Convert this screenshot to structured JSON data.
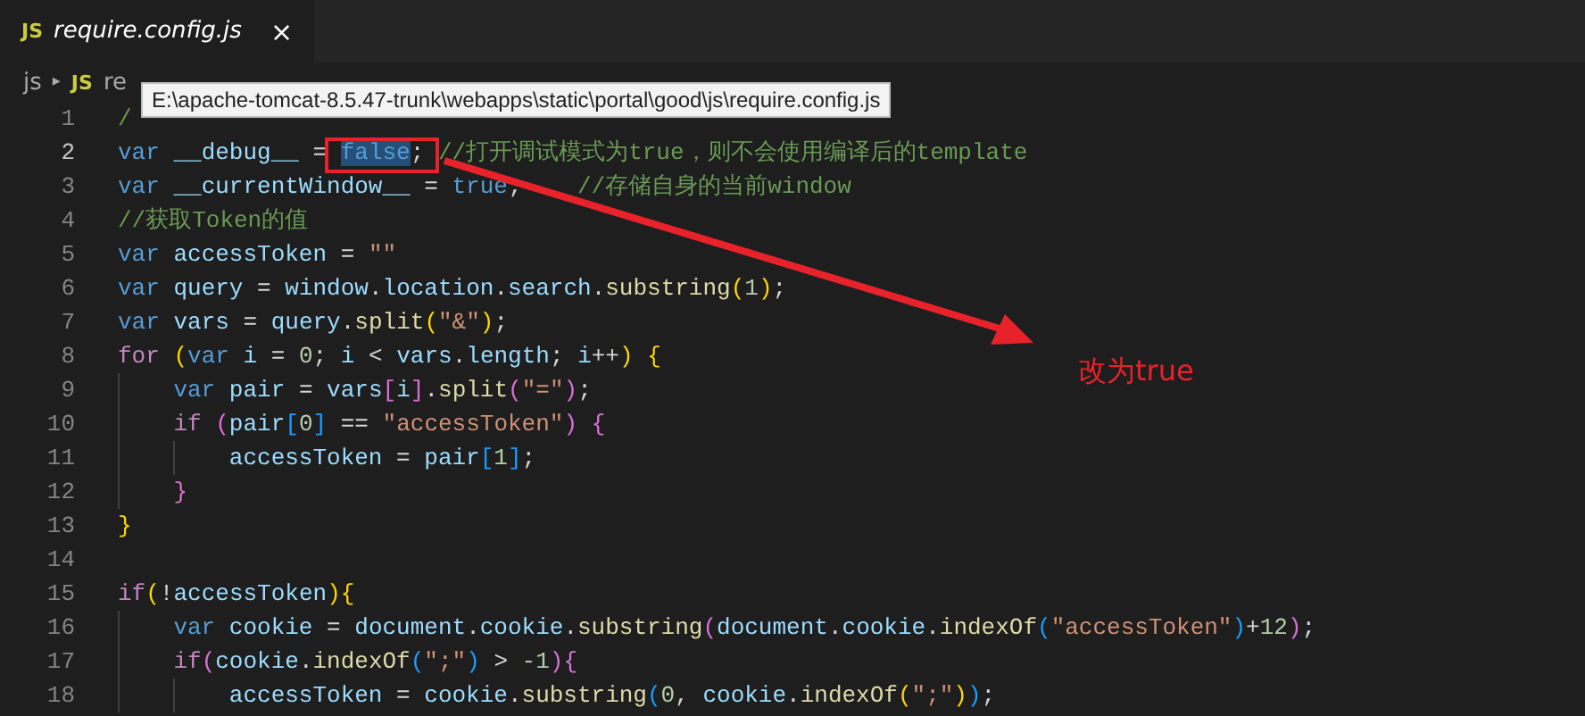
{
  "tabs": [
    {
      "badge": "JS",
      "label": "require.config.js",
      "close": "×",
      "selected": true
    }
  ],
  "breadcrumb": {
    "folder": "js",
    "separator": "▸",
    "badge": "JS",
    "file": "re"
  },
  "tooltip": "E:\\apache-tomcat-8.5.47-trunk\\webapps\\static\\portal\\good\\js\\require.config.js",
  "lines": [
    {
      "number": "1",
      "current": false,
      "tokens": [
        {
          "text": "/",
          "kind": "comment"
        }
      ]
    },
    {
      "number": "2",
      "current": true,
      "tokens": [
        {
          "text": "var ",
          "kind": "keyword"
        },
        {
          "text": "__debug__",
          "kind": "variable"
        },
        {
          "text": " = ",
          "kind": "plain"
        },
        {
          "text": "false",
          "kind": "keyword",
          "selected": true
        },
        {
          "text": "; ",
          "kind": "plain"
        },
        {
          "text": "//打开调试模式为true，则不会使用编译后的template",
          "kind": "comment"
        }
      ]
    },
    {
      "number": "3",
      "current": false,
      "tokens": [
        {
          "text": "var ",
          "kind": "keyword"
        },
        {
          "text": "__currentWindow__",
          "kind": "variable"
        },
        {
          "text": " = ",
          "kind": "plain"
        },
        {
          "text": "true",
          "kind": "keyword"
        },
        {
          "text": ";    ",
          "kind": "plain"
        },
        {
          "text": "//存储自身的当前window",
          "kind": "comment"
        }
      ]
    },
    {
      "number": "4",
      "current": false,
      "tokens": [
        {
          "text": "//获取Token的值",
          "kind": "comment"
        }
      ]
    },
    {
      "number": "5",
      "current": false,
      "tokens": [
        {
          "text": "var ",
          "kind": "keyword"
        },
        {
          "text": "accessToken",
          "kind": "variable"
        },
        {
          "text": " = ",
          "kind": "plain"
        },
        {
          "text": "\"\"",
          "kind": "string"
        }
      ]
    },
    {
      "number": "6",
      "current": false,
      "tokens": [
        {
          "text": "var ",
          "kind": "keyword"
        },
        {
          "text": "query",
          "kind": "variable"
        },
        {
          "text": " = ",
          "kind": "plain"
        },
        {
          "text": "window",
          "kind": "variable"
        },
        {
          "text": ".",
          "kind": "plain"
        },
        {
          "text": "location",
          "kind": "variable"
        },
        {
          "text": ".",
          "kind": "plain"
        },
        {
          "text": "search",
          "kind": "variable"
        },
        {
          "text": ".",
          "kind": "plain"
        },
        {
          "text": "substring",
          "kind": "function"
        },
        {
          "text": "(",
          "kind": "bracket1"
        },
        {
          "text": "1",
          "kind": "number"
        },
        {
          "text": ")",
          "kind": "bracket1"
        },
        {
          "text": ";",
          "kind": "plain"
        }
      ]
    },
    {
      "number": "7",
      "current": false,
      "tokens": [
        {
          "text": "var ",
          "kind": "keyword"
        },
        {
          "text": "vars",
          "kind": "variable"
        },
        {
          "text": " = ",
          "kind": "plain"
        },
        {
          "text": "query",
          "kind": "variable"
        },
        {
          "text": ".",
          "kind": "plain"
        },
        {
          "text": "split",
          "kind": "function"
        },
        {
          "text": "(",
          "kind": "bracket1"
        },
        {
          "text": "\"&\"",
          "kind": "string"
        },
        {
          "text": ")",
          "kind": "bracket1"
        },
        {
          "text": ";",
          "kind": "plain"
        }
      ]
    },
    {
      "number": "8",
      "current": false,
      "tokens": [
        {
          "text": "for ",
          "kind": "control"
        },
        {
          "text": "(",
          "kind": "bracket1"
        },
        {
          "text": "var ",
          "kind": "keyword"
        },
        {
          "text": "i",
          "kind": "variable"
        },
        {
          "text": " = ",
          "kind": "plain"
        },
        {
          "text": "0",
          "kind": "number"
        },
        {
          "text": "; ",
          "kind": "plain"
        },
        {
          "text": "i",
          "kind": "variable"
        },
        {
          "text": " < ",
          "kind": "plain"
        },
        {
          "text": "vars",
          "kind": "variable"
        },
        {
          "text": ".",
          "kind": "plain"
        },
        {
          "text": "length",
          "kind": "variable"
        },
        {
          "text": "; ",
          "kind": "plain"
        },
        {
          "text": "i",
          "kind": "variable"
        },
        {
          "text": "++",
          "kind": "plain"
        },
        {
          "text": ") {",
          "kind": "bracket1"
        }
      ]
    },
    {
      "number": "9",
      "current": false,
      "tokens": [
        {
          "text": "    var ",
          "kind": "keyword"
        },
        {
          "text": "pair",
          "kind": "variable"
        },
        {
          "text": " = ",
          "kind": "plain"
        },
        {
          "text": "vars",
          "kind": "variable"
        },
        {
          "text": "[",
          "kind": "bracket2"
        },
        {
          "text": "i",
          "kind": "variable"
        },
        {
          "text": "]",
          "kind": "bracket2"
        },
        {
          "text": ".",
          "kind": "plain"
        },
        {
          "text": "split",
          "kind": "function"
        },
        {
          "text": "(",
          "kind": "bracket2"
        },
        {
          "text": "\"=\"",
          "kind": "string"
        },
        {
          "text": ")",
          "kind": "bracket2"
        },
        {
          "text": ";",
          "kind": "plain"
        }
      ]
    },
    {
      "number": "10",
      "current": false,
      "tokens": [
        {
          "text": "    if ",
          "kind": "control"
        },
        {
          "text": "(",
          "kind": "bracket2"
        },
        {
          "text": "pair",
          "kind": "variable"
        },
        {
          "text": "[",
          "kind": "bracket3"
        },
        {
          "text": "0",
          "kind": "number"
        },
        {
          "text": "]",
          "kind": "bracket3"
        },
        {
          "text": " == ",
          "kind": "plain"
        },
        {
          "text": "\"accessToken\"",
          "kind": "string"
        },
        {
          "text": ") {",
          "kind": "bracket2"
        }
      ]
    },
    {
      "number": "11",
      "current": false,
      "tokens": [
        {
          "text": "        accessToken",
          "kind": "variable"
        },
        {
          "text": " = ",
          "kind": "plain"
        },
        {
          "text": "pair",
          "kind": "variable"
        },
        {
          "text": "[",
          "kind": "bracket3"
        },
        {
          "text": "1",
          "kind": "number"
        },
        {
          "text": "]",
          "kind": "bracket3"
        },
        {
          "text": ";",
          "kind": "plain"
        }
      ]
    },
    {
      "number": "12",
      "current": false,
      "tokens": [
        {
          "text": "    }",
          "kind": "bracket2"
        }
      ]
    },
    {
      "number": "13",
      "current": false,
      "tokens": [
        {
          "text": "}",
          "kind": "bracket1"
        }
      ]
    },
    {
      "number": "14",
      "current": false
    },
    {
      "number": "15",
      "current": false,
      "tokens": [
        {
          "text": "if",
          "kind": "control"
        },
        {
          "text": "(",
          "kind": "bracket1"
        },
        {
          "text": "!",
          "kind": "plain"
        },
        {
          "text": "accessToken",
          "kind": "variable"
        },
        {
          "text": "){",
          "kind": "bracket1"
        }
      ]
    },
    {
      "number": "16",
      "current": false,
      "tokens": [
        {
          "text": "    var ",
          "kind": "keyword"
        },
        {
          "text": "cookie",
          "kind": "variable"
        },
        {
          "text": " = ",
          "kind": "plain"
        },
        {
          "text": "document",
          "kind": "variable"
        },
        {
          "text": ".",
          "kind": "plain"
        },
        {
          "text": "cookie",
          "kind": "variable"
        },
        {
          "text": ".",
          "kind": "plain"
        },
        {
          "text": "substring",
          "kind": "function"
        },
        {
          "text": "(",
          "kind": "bracket2"
        },
        {
          "text": "document",
          "kind": "variable"
        },
        {
          "text": ".",
          "kind": "plain"
        },
        {
          "text": "cookie",
          "kind": "variable"
        },
        {
          "text": ".",
          "kind": "plain"
        },
        {
          "text": "indexOf",
          "kind": "function"
        },
        {
          "text": "(",
          "kind": "bracket3"
        },
        {
          "text": "\"accessToken\"",
          "kind": "string"
        },
        {
          "text": ")",
          "kind": "bracket3"
        },
        {
          "text": "+",
          "kind": "plain"
        },
        {
          "text": "12",
          "kind": "number"
        },
        {
          "text": ")",
          "kind": "bracket2"
        },
        {
          "text": ";",
          "kind": "plain"
        }
      ]
    },
    {
      "number": "17",
      "current": false,
      "tokens": [
        {
          "text": "    if",
          "kind": "control"
        },
        {
          "text": "(",
          "kind": "bracket2"
        },
        {
          "text": "cookie",
          "kind": "variable"
        },
        {
          "text": ".",
          "kind": "plain"
        },
        {
          "text": "indexOf",
          "kind": "function"
        },
        {
          "text": "(",
          "kind": "bracket3"
        },
        {
          "text": "\";\"",
          "kind": "string"
        },
        {
          "text": ")",
          "kind": "bracket3"
        },
        {
          "text": " > ",
          "kind": "plain"
        },
        {
          "text": "-1",
          "kind": "number"
        },
        {
          "text": "){",
          "kind": "bracket2"
        }
      ]
    },
    {
      "number": "18",
      "current": false,
      "tokens": [
        {
          "text": "        accessToken",
          "kind": "variable"
        },
        {
          "text": " = ",
          "kind": "plain"
        },
        {
          "text": "cookie",
          "kind": "variable"
        },
        {
          "text": ".",
          "kind": "plain"
        },
        {
          "text": "substring",
          "kind": "function"
        },
        {
          "text": "(",
          "kind": "bracket3"
        },
        {
          "text": "0",
          "kind": "number"
        },
        {
          "text": ", ",
          "kind": "plain"
        },
        {
          "text": "cookie",
          "kind": "variable"
        },
        {
          "text": ".",
          "kind": "plain"
        },
        {
          "text": "indexOf",
          "kind": "function"
        },
        {
          "text": "(",
          "kind": "bracket1"
        },
        {
          "text": "\";\"",
          "kind": "string"
        },
        {
          "text": ")",
          "kind": "bracket1"
        },
        {
          "text": ")",
          "kind": "bracket3"
        },
        {
          "text": ";",
          "kind": "plain"
        }
      ]
    }
  ],
  "annotation": {
    "note": "改为true"
  }
}
